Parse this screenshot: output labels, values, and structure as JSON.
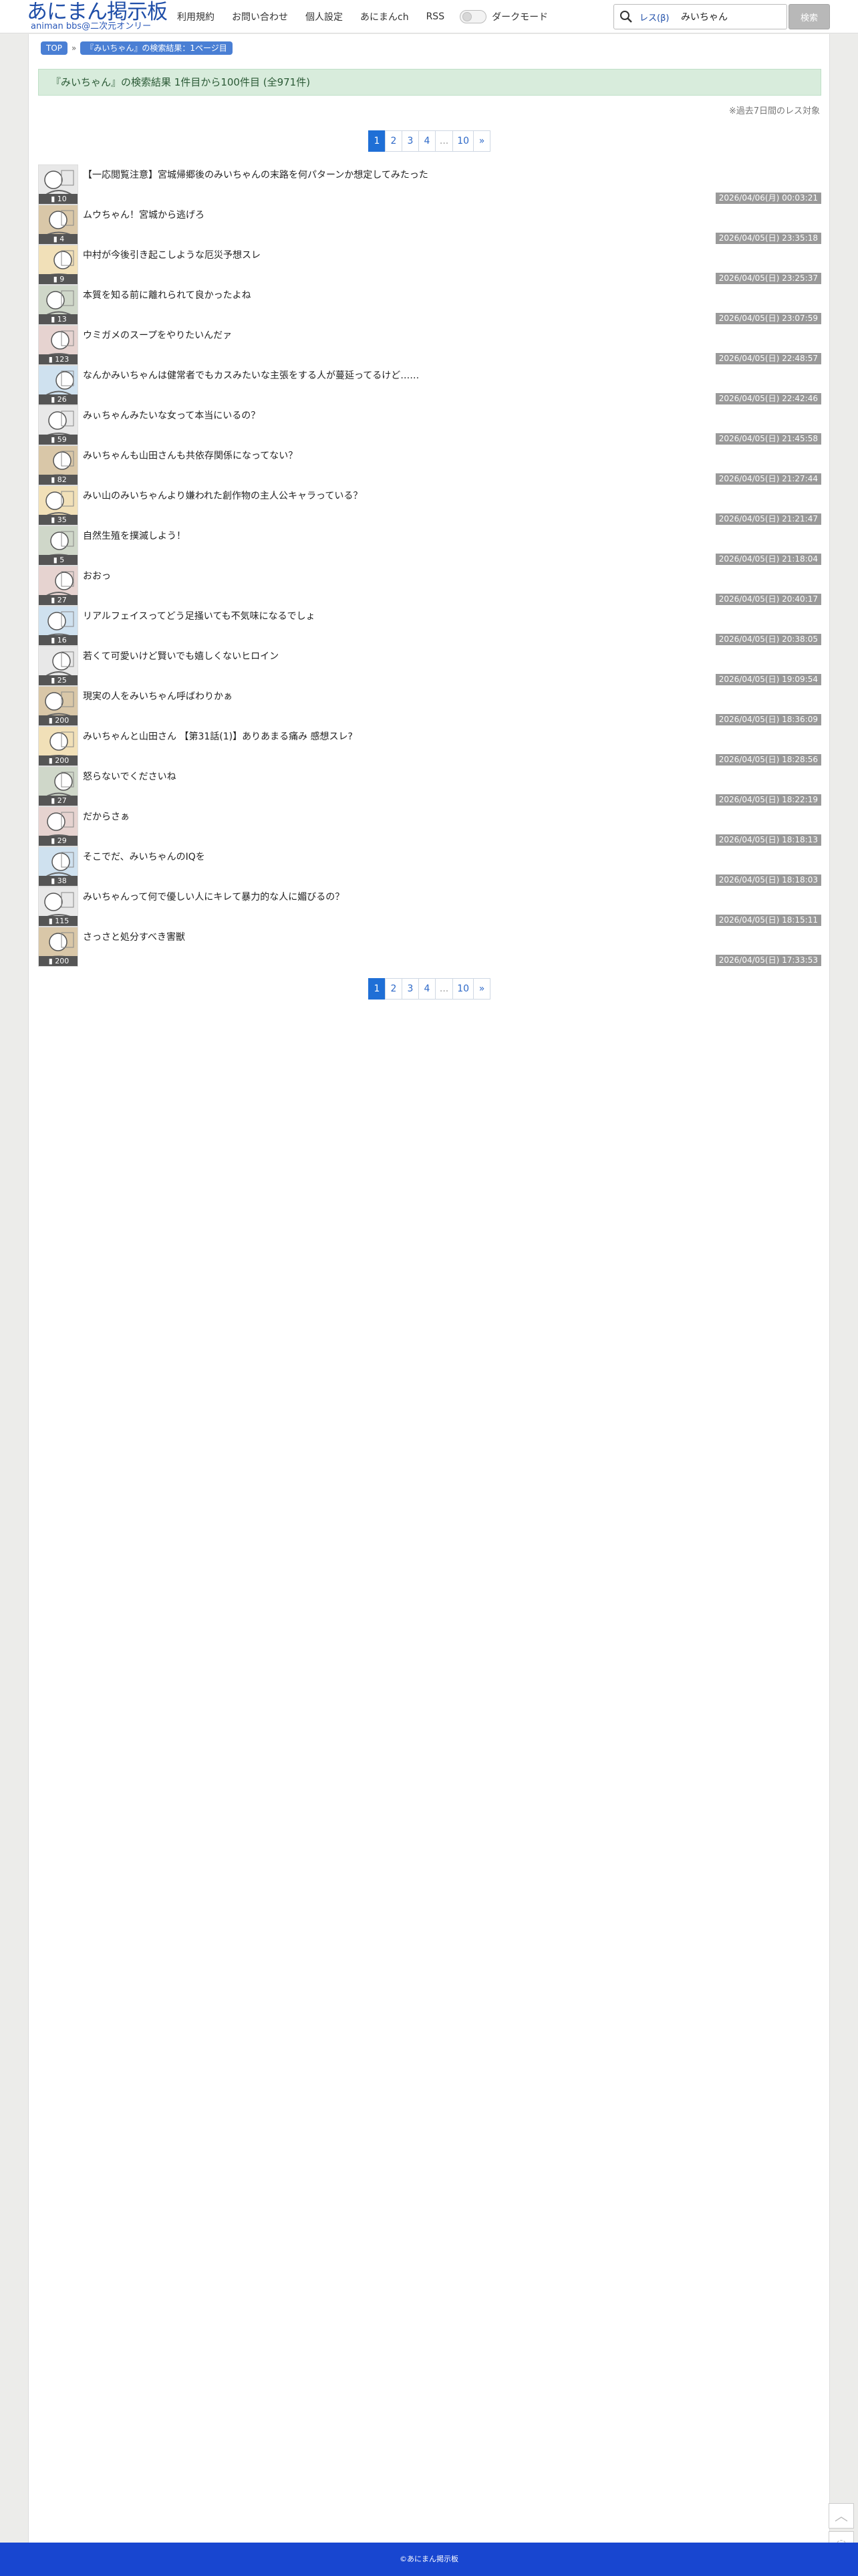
{
  "header": {
    "logo_title": "あにまん掲示板",
    "logo_sub": "animan bbs@二次元オンリー",
    "nav": [
      "利用規約",
      "お問い合わせ",
      "個人設定",
      "あにまんch",
      "RSS"
    ],
    "dark_mode_label": "ダークモード",
    "search_scope": "レス(β)",
    "search_value": "みいちゃん",
    "search_button": "検索"
  },
  "breadcrumb": [
    "TOP",
    "『みいちゃん』の検索結果：1ページ目"
  ],
  "result_heading": "『みいちゃん』の検索結果 1件目から100件目 (全971件)",
  "note": "※過去7日間のレス対象",
  "pager": [
    "1",
    "2",
    "3",
    "4",
    "...",
    "10",
    "»"
  ],
  "threads": [
    {
      "title": "【一応閲覧注意】宮城帰郷後のみいちゃんの末路を何パターンか想定してみたった",
      "count": "10",
      "date": "2026/04/06(月) 00:03:21"
    },
    {
      "title": "ムウちゃん！宮城から逃げろ",
      "count": "4",
      "date": "2026/04/05(日) 23:35:18"
    },
    {
      "title": "中村が今後引き起こしような厄災予想スレ",
      "count": "9",
      "date": "2026/04/05(日) 23:25:37"
    },
    {
      "title": "本質を知る前に離れられて良かったよね",
      "count": "13",
      "date": "2026/04/05(日) 23:07:59"
    },
    {
      "title": "ウミガメのスープをやりたいんだァ",
      "count": "123",
      "date": "2026/04/05(日) 22:48:57"
    },
    {
      "title": "なんかみいちゃんは健常者でもカスみたいな主張をする人が蔓延ってるけど……",
      "count": "26",
      "date": "2026/04/05(日) 22:42:46"
    },
    {
      "title": "みぃちゃんみたいな女って本当にいるの？",
      "count": "59",
      "date": "2026/04/05(日) 21:45:58"
    },
    {
      "title": "みいちゃんも山田さんも共依存関係になってない？",
      "count": "82",
      "date": "2026/04/05(日) 21:27:44"
    },
    {
      "title": "みい山のみいちゃんより嫌われた創作物の主人公キャラっている？",
      "count": "35",
      "date": "2026/04/05(日) 21:21:47"
    },
    {
      "title": "自然生殖を撲滅しよう！",
      "count": "5",
      "date": "2026/04/05(日) 21:18:04"
    },
    {
      "title": "おおっ",
      "count": "27",
      "date": "2026/04/05(日) 20:40:17"
    },
    {
      "title": "リアルフェイスってどう足掻いても不気味になるでしょ",
      "count": "16",
      "date": "2026/04/05(日) 20:38:05"
    },
    {
      "title": "若くて可愛いけど賢いでも嬉しくないヒロイン",
      "count": "25",
      "date": "2026/04/05(日) 19:09:54"
    },
    {
      "title": "現実の人をみいちゃん呼ばわりかぁ",
      "count": "200",
      "date": "2026/04/05(日) 18:36:09"
    },
    {
      "title": "みいちゃんと山田さん 【第31話(1)】ありあまる痛み 感想スレ?",
      "count": "200",
      "date": "2026/04/05(日) 18:28:56"
    },
    {
      "title": "怒らないでくださいね",
      "count": "27",
      "date": "2026/04/05(日) 18:22:19"
    },
    {
      "title": "だからさぁ",
      "count": "29",
      "date": "2026/04/05(日) 18:18:13"
    },
    {
      "title": "そこでだ、みいちゃんのIQを",
      "count": "38",
      "date": "2026/04/05(日) 18:18:03"
    },
    {
      "title": "みいちゃんって何で優しい人にキレて暴力的な人に媚びるの？",
      "count": "115",
      "date": "2026/04/05(日) 18:15:11"
    },
    {
      "title": "さっさと処分すべき害獣",
      "count": "200",
      "date": "2026/04/05(日) 17:33:53"
    }
  ],
  "footer": "©あにまん掲示板",
  "colors": {
    "accent": "#1f6fd6",
    "footer": "#1846d0",
    "result_bg": "#d8ecdc"
  }
}
